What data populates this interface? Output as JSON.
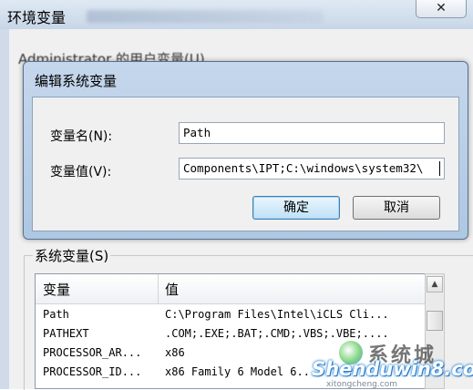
{
  "env_window": {
    "title": "环境变量",
    "close_glyph": "✕",
    "user_vars_label": "Administrator 的用户变量(U)"
  },
  "system_vars": {
    "group_label": "系统变量(S)",
    "columns": [
      "变量",
      "值"
    ],
    "rows": [
      {
        "name": "Path",
        "value": "C:\\Program Files\\Intel\\iCLS Cli..."
      },
      {
        "name": "PATHEXT",
        "value": ".COM;.EXE;.BAT;.CMD;.VBS;.VBE;...."
      },
      {
        "name": "PROCESSOR_AR...",
        "value": "x86"
      },
      {
        "name": "PROCESSOR_ID...",
        "value": "x86 Family 6 Model 6..."
      }
    ]
  },
  "dialog": {
    "title": "编辑系统变量",
    "var_name_label": "变量名(N):",
    "var_value_label": "变量值(V):",
    "var_name": "Path",
    "var_value": "Components\\IPT;C:\\windows\\system32\\",
    "ok_label": "确定",
    "cancel_label": "取消"
  },
  "watermark": {
    "brand_cn": "系统城",
    "brand": "Shenduwin8.com",
    "sub": "xitongcheng.com"
  },
  "icons": {
    "close": "close-icon",
    "scroll_up": "scroll-up-arrow-icon",
    "logo": "watermark-logo-icon"
  }
}
